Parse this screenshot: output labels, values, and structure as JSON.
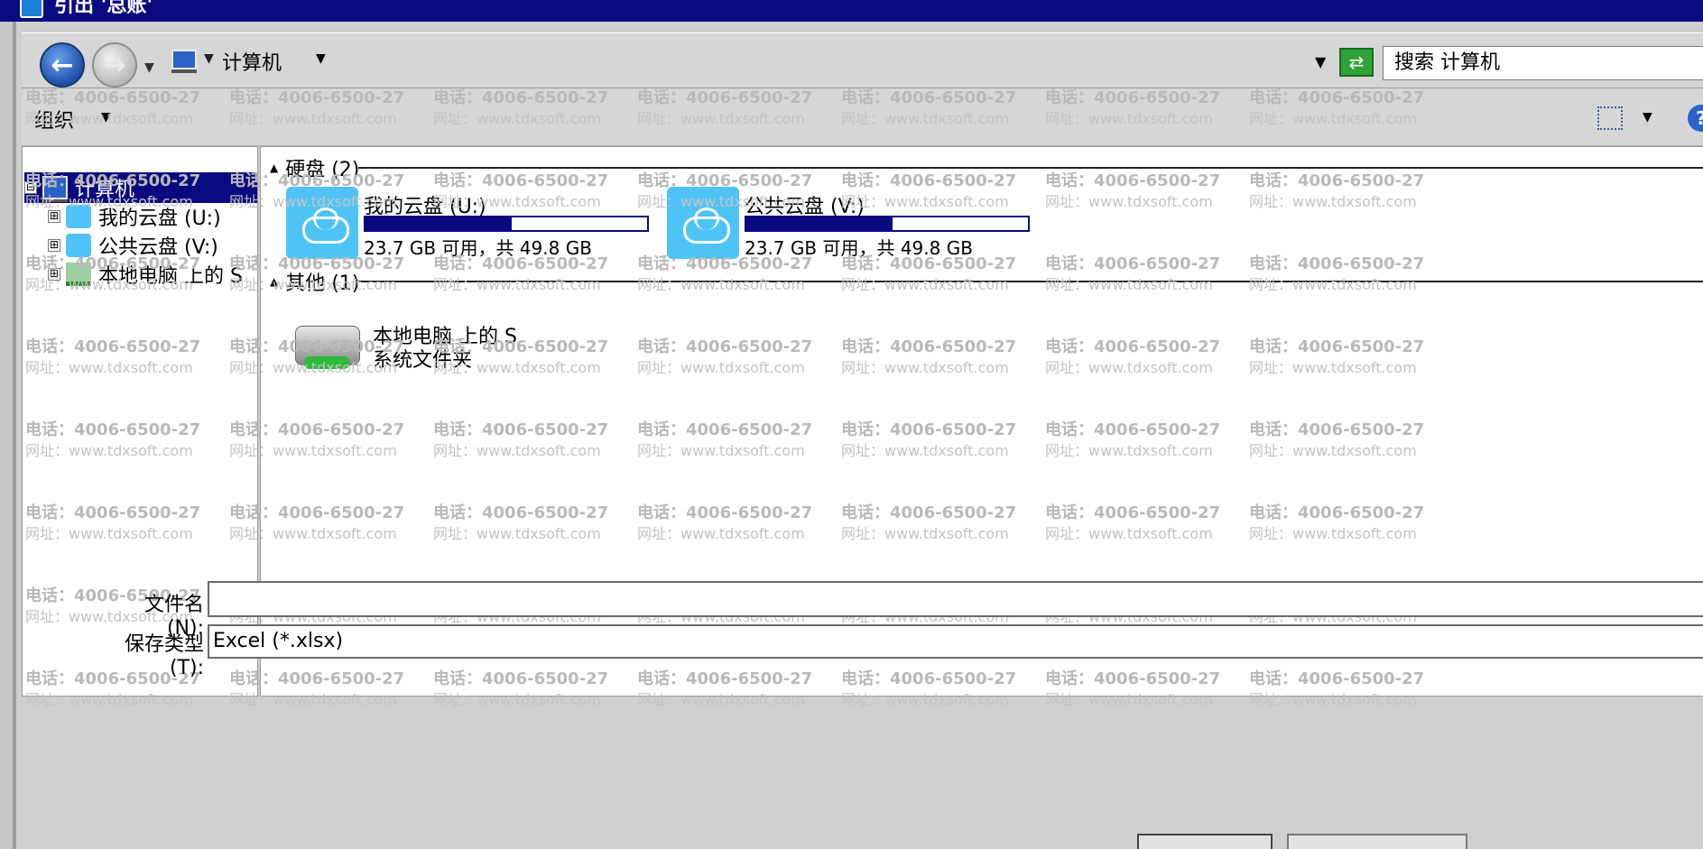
{
  "window": {
    "title": "引出 '总账'"
  },
  "address_bar": {
    "back_icon": "back-arrow-icon",
    "forward_icon": "forward-arrow-icon",
    "location_label": "计算机",
    "search_placeholder": "搜索 计算机"
  },
  "toolbar": {
    "organize_label": "组织"
  },
  "nav_tree": {
    "root": {
      "label": "计算机",
      "expander": "⊟"
    },
    "items": [
      {
        "label": "我的云盘 (U:)",
        "expander": "⊞"
      },
      {
        "label": "公共云盘 (V:)",
        "expander": "⊞"
      },
      {
        "label": "本地电脑 上的 S",
        "expander": "⊞"
      }
    ]
  },
  "content": {
    "groups": [
      {
        "label": "硬盘 (2)"
      },
      {
        "label": "其他 (1)"
      }
    ],
    "drives": [
      {
        "name": "我的云盘 (U:)",
        "space_text": "23.7 GB 可用，共 49.8 GB",
        "used_fraction": 0.52
      },
      {
        "name": "公共云盘 (V:)",
        "space_text": "23.7 GB 可用，共 49.8 GB",
        "used_fraction": 0.52
      }
    ],
    "other_item": {
      "name": "本地电脑 上的 S",
      "subtitle": "系统文件夹"
    }
  },
  "watermark": {
    "phone": "电话：4006-6500-27",
    "site": "网址：www.tdxsoft.com"
  },
  "form": {
    "filename_label": "文件名(N):",
    "filename_value": "",
    "filetype_label": "保存类型(T):",
    "filetype_value": "Excel (*.xlsx)"
  },
  "colors": {
    "selection": "#0a0a80",
    "cloud": "#4fc3f7"
  }
}
